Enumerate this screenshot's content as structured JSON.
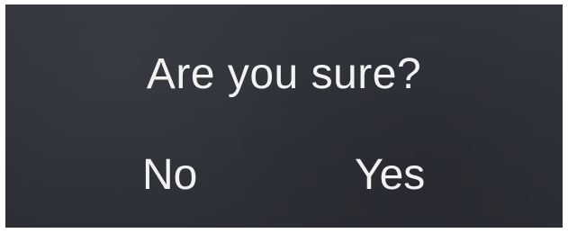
{
  "dialog": {
    "message": "Are you sure?",
    "no_label": "No",
    "yes_label": "Yes",
    "colors": {
      "background": "#2e3038",
      "text": "#f2f2f2"
    }
  }
}
